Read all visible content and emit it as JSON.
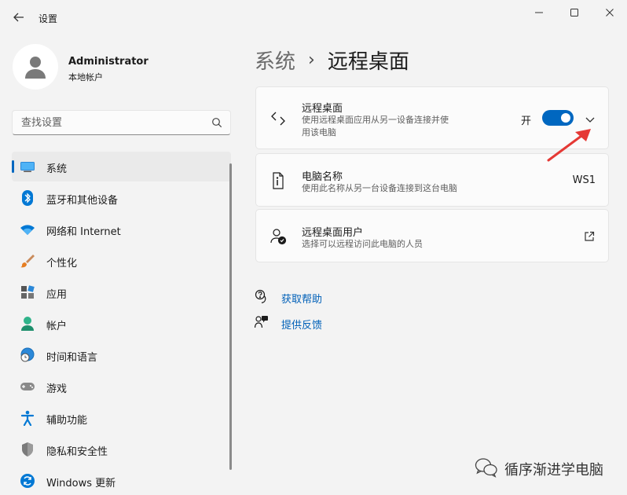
{
  "window": {
    "title": "设置",
    "controls": [
      "minimize-icon",
      "maximize-icon",
      "close-icon"
    ]
  },
  "profile": {
    "name": "Administrator",
    "account_type": "本地帐户"
  },
  "search": {
    "placeholder": "查找设置",
    "value": ""
  },
  "sidebar": {
    "items": [
      {
        "label": "系统",
        "icon": "system-icon",
        "active": true
      },
      {
        "label": "蓝牙和其他设备",
        "icon": "bluetooth-icon"
      },
      {
        "label": "网络和 Internet",
        "icon": "wifi-icon"
      },
      {
        "label": "个性化",
        "icon": "brush-icon"
      },
      {
        "label": "应用",
        "icon": "apps-icon"
      },
      {
        "label": "帐户",
        "icon": "account-icon"
      },
      {
        "label": "时间和语言",
        "icon": "globe-clock-icon"
      },
      {
        "label": "游戏",
        "icon": "gamepad-icon"
      },
      {
        "label": "辅助功能",
        "icon": "accessibility-icon"
      },
      {
        "label": "隐私和安全性",
        "icon": "shield-icon"
      },
      {
        "label": "Windows 更新",
        "icon": "update-icon"
      }
    ]
  },
  "breadcrumb": {
    "parent": "系统",
    "separator": "›",
    "current": "远程桌面"
  },
  "cards": {
    "remote_desktop": {
      "title": "远程桌面",
      "description": "使用远程桌面应用从另一设备连接并使用该电脑",
      "toggle_label": "开",
      "toggle_on": true
    },
    "pc_name": {
      "title": "电脑名称",
      "description": "使用此名称从另一台设备连接到这台电脑",
      "value": "WS1"
    },
    "remote_users": {
      "title": "远程桌面用户",
      "description": "选择可以远程访问此电脑的人员"
    }
  },
  "links": {
    "help": "获取帮助",
    "feedback": "提供反馈"
  },
  "watermark": {
    "text": "循序渐进学电脑"
  },
  "colors": {
    "accent": "#0067c0",
    "link": "#0060b8",
    "annotation": "#e53935",
    "background": "#f3f3f3",
    "card": "#fbfbfb"
  }
}
